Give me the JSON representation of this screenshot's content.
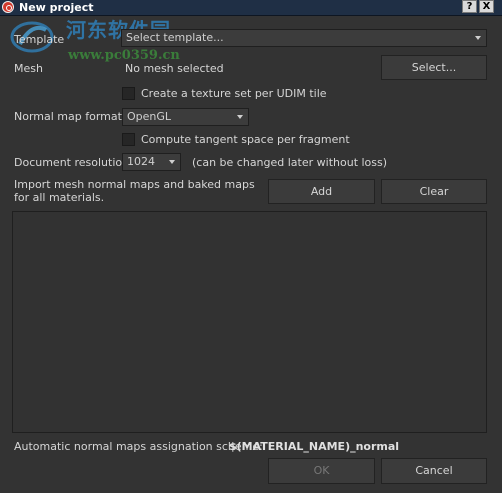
{
  "window": {
    "title": "New project",
    "help_label": "?",
    "close_label": "X"
  },
  "watermark": {
    "site_name": "河东软件园",
    "url": "www.pc0359.cn"
  },
  "template": {
    "label": "Template",
    "value": "Select template..."
  },
  "mesh": {
    "label": "Mesh",
    "value": "No mesh selected",
    "select_button": "Select..."
  },
  "udim": {
    "label": "Create a texture set per UDIM tile",
    "checked": false
  },
  "normal_map_format": {
    "label": "Normal map format",
    "value": "OpenGL"
  },
  "tangent": {
    "label": "Compute tangent space per fragment",
    "checked": false
  },
  "resolution": {
    "label": "Document resolution",
    "value": "1024",
    "note": "(can be changed later without loss)"
  },
  "import": {
    "label": "Import mesh normal maps and baked maps for all materials.",
    "add_button": "Add",
    "clear_button": "Clear"
  },
  "scheme": {
    "label": "Automatic normal maps assignation scheme:",
    "value": "$(MATERIAL_NAME)_normal"
  },
  "footer": {
    "ok_button": "OK",
    "cancel_button": "Cancel"
  }
}
